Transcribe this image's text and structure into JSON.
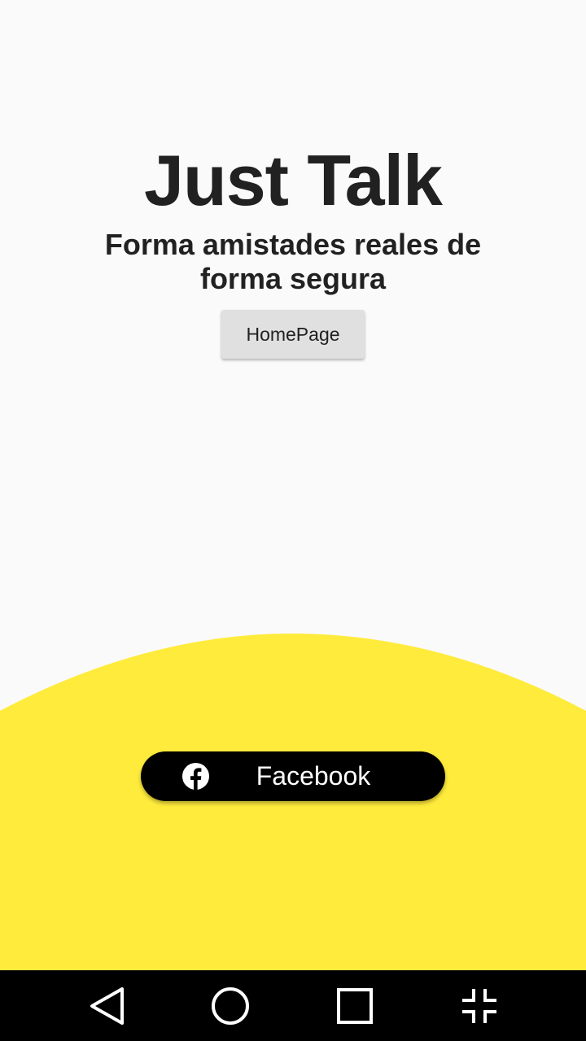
{
  "app": {
    "title": "Just Talk",
    "subtitle": "Forma amistades reales de forma segura"
  },
  "buttons": {
    "homepage_label": "HomePage",
    "facebook_label": "Facebook"
  },
  "colors": {
    "background": "#fafafa",
    "accent_yellow": "#ffeb3b",
    "text_dark": "#212121",
    "facebook_button": "#000000"
  },
  "icons": {
    "facebook": "facebook-icon",
    "nav_back": "back-triangle-icon",
    "nav_home": "home-circle-icon",
    "nav_recents": "recents-square-icon",
    "nav_exit_fullscreen": "exit-fullscreen-icon"
  }
}
